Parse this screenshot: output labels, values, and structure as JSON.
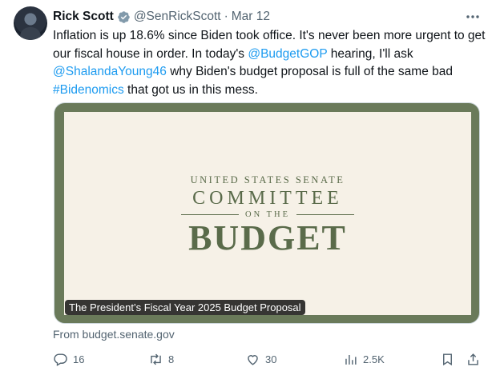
{
  "tweet": {
    "author_name": "Rick Scott",
    "handle": "@SenRickScott",
    "separator": "·",
    "date": "Mar 12",
    "text": {
      "p1": "Inflation is up 18.6% since Biden took office. It's never been more urgent to get our fiscal house in order. In today's ",
      "mention1": "@BudgetGOP",
      "p2": " hearing, I'll ask ",
      "mention2": "@ShalandaYoung46",
      "p3": " why Biden's budget proposal is full of the same bad ",
      "hashtag": "#Bidenomics",
      "p4": " that got us in this mess."
    },
    "link_color": "#1d9bf0"
  },
  "card": {
    "seal_line1": "UNITED STATES SENATE",
    "seal_line2": "COMMITTEE",
    "seal_line3": "ON THE",
    "seal_line4": "BUDGET",
    "caption": "The President’s Fiscal Year 2025 Budget Proposal",
    "source": "From budget.senate.gov",
    "frame_color": "#6a7a5a",
    "seal_color": "#5a6b4a"
  },
  "actions": {
    "replies": "16",
    "retweets": "8",
    "likes": "30",
    "views": "2.5K"
  }
}
